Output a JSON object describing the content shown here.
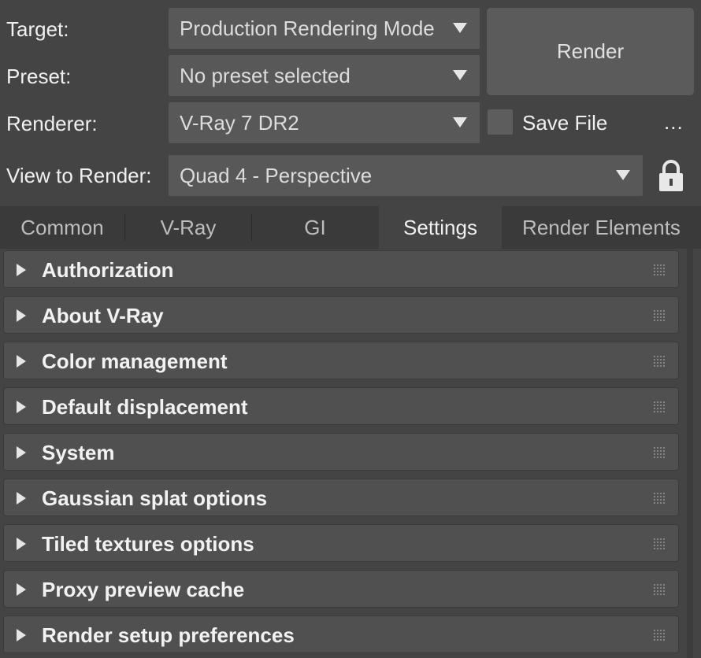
{
  "top": {
    "target_label": "Target:",
    "target_value": "Production Rendering Mode",
    "preset_label": "Preset:",
    "preset_value": "No preset selected",
    "renderer_label": "Renderer:",
    "renderer_value": "V-Ray 7 DR2",
    "view_label": "View to Render:",
    "view_value": "Quad 4 - Perspective",
    "render_button": "Render",
    "save_file_label": "Save File",
    "save_file_checked": false,
    "ellipsis": "...",
    "lock_icon": "lock-icon"
  },
  "tabs": [
    {
      "label": "Common",
      "active": false
    },
    {
      "label": "V-Ray",
      "active": false
    },
    {
      "label": "GI",
      "active": false
    },
    {
      "label": "Settings",
      "active": true
    },
    {
      "label": "Render Elements",
      "active": false
    }
  ],
  "rollouts": [
    {
      "title": "Authorization"
    },
    {
      "title": "About V-Ray"
    },
    {
      "title": "Color management"
    },
    {
      "title": "Default displacement"
    },
    {
      "title": "System"
    },
    {
      "title": "Gaussian splat options"
    },
    {
      "title": "Tiled textures options"
    },
    {
      "title": "Proxy preview cache"
    },
    {
      "title": "Render setup preferences"
    }
  ],
  "colors": {
    "background": "#444444",
    "dropdown": "#585858",
    "rollout": "#505050",
    "text": "#f0f0f0"
  }
}
